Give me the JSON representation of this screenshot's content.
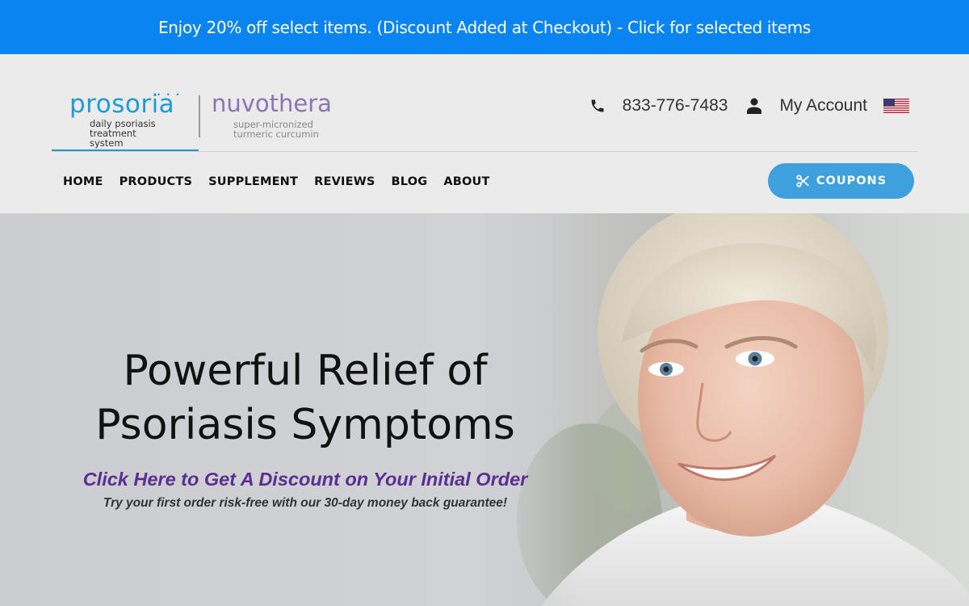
{
  "promo": {
    "text": "Enjoy 20% off select items. (Discount Added at Checkout) - Click for selected items",
    "color": "#0a84f0"
  },
  "header": {
    "logo_prosoria": {
      "name": "prosoria",
      "tagline_line1": "daily psoriasis",
      "tagline_line2": "treatment system",
      "color": "#1c9bd4"
    },
    "logo_nuvothera": {
      "name": "nuvothera",
      "tagline_line1": "super-micronized",
      "tagline_line2": "turmeric curcumin",
      "color": "#8f74b3"
    },
    "phone": "833-776-7483",
    "account_label": "My Account",
    "flag_icon": "us-flag-icon",
    "phone_icon": "phone-icon",
    "account_icon": "user-icon"
  },
  "nav": {
    "items": [
      "HOME",
      "PRODUCTS",
      "SUPPLEMENT",
      "REVIEWS",
      "BLOG",
      "ABOUT"
    ]
  },
  "coupons": {
    "label": "COUPONS",
    "icon": "scissors-icon",
    "color": "#3ea0dc"
  },
  "hero": {
    "title_line1": "Powerful Relief of",
    "title_line2": "Psoriasis Symptoms",
    "cta": "Click Here to Get A Discount on Your Initial Order",
    "subtext": "Try your first order risk-free with our 30-day money back guarantee!",
    "cta_color": "#5b2e91"
  }
}
